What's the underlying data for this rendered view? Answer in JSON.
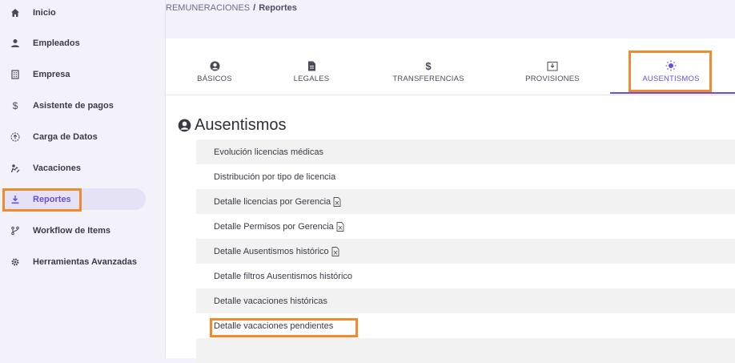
{
  "sidebar": {
    "items": [
      {
        "label": "Inicio",
        "icon": "home-icon"
      },
      {
        "label": "Empleados",
        "icon": "user-icon"
      },
      {
        "label": "Empresa",
        "icon": "building-icon"
      },
      {
        "label": "Asistente de pagos",
        "icon": "dollar-icon"
      },
      {
        "label": "Carga de Datos",
        "icon": "upload-circle-icon"
      },
      {
        "label": "Vacaciones",
        "icon": "beach-icon"
      },
      {
        "label": "Reportes",
        "icon": "download-icon",
        "active": true
      },
      {
        "label": "Workflow de Items",
        "icon": "branch-icon"
      },
      {
        "label": "Herramientas Avanzadas",
        "icon": "gear-icon"
      }
    ]
  },
  "breadcrumb": {
    "parent": "REMUNERACIONES",
    "separator": "/",
    "current": "Reportes"
  },
  "tabs": [
    {
      "label": "BÁSICOS",
      "icon": "user-circle-icon"
    },
    {
      "label": "LEGALES",
      "icon": "document-icon"
    },
    {
      "label": "TRANSFERENCIAS",
      "icon": "dollar-icon",
      "glyph": "$"
    },
    {
      "label": "PROVISIONES",
      "icon": "inbox-download-icon"
    },
    {
      "label": "AUSENTISMOS",
      "icon": "sun-icon",
      "active": true
    }
  ],
  "section": {
    "title": "Ausentismos",
    "icon": "user-circle-icon"
  },
  "reports": [
    {
      "label": "Evolución licencias médicas",
      "excel": false
    },
    {
      "label": "Distribución por tipo de licencia",
      "excel": false
    },
    {
      "label": "Detalle licencias por Gerencia",
      "excel": true
    },
    {
      "label": "Detalle Permisos por Gerencia",
      "excel": true
    },
    {
      "label": "Detalle Ausentismos histórico",
      "excel": true
    },
    {
      "label": "Detalle filtros Ausentismos histórico",
      "excel": false
    },
    {
      "label": "Detalle vacaciones históricas",
      "excel": false
    },
    {
      "label": "Detalle vacaciones pendientes",
      "excel": false
    }
  ],
  "colors": {
    "accent": "#6b4fd8",
    "highlight": "#f08a2c",
    "row_alt": "#f2f2f2"
  }
}
